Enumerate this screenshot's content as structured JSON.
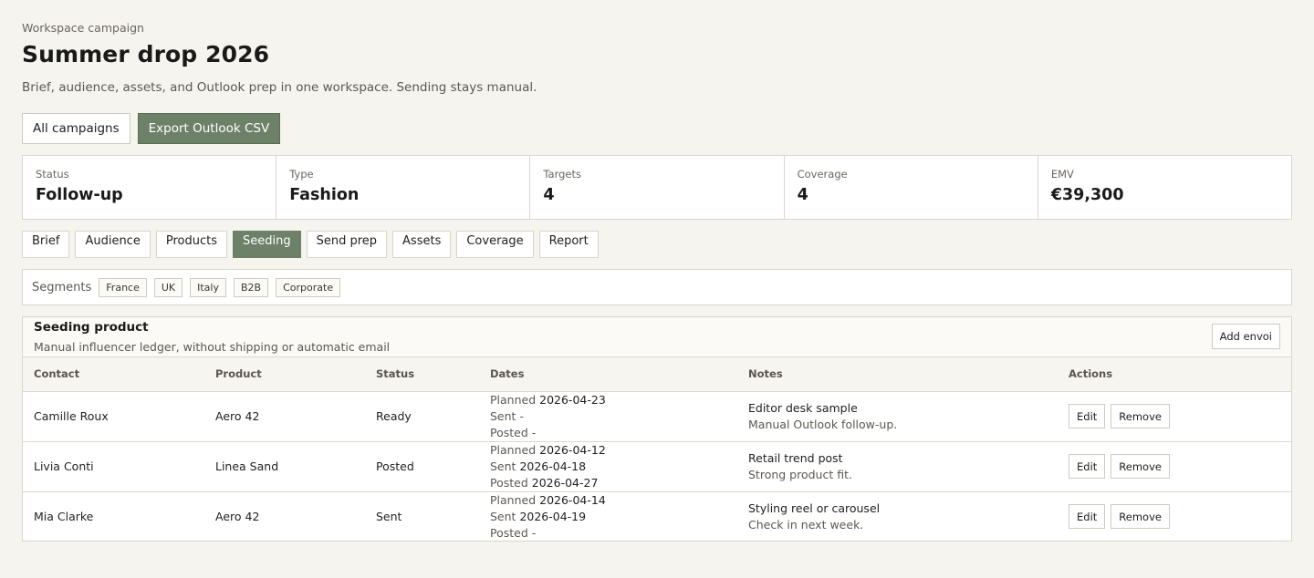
{
  "header": {
    "eyebrow": "Workspace campaign",
    "title": "Summer drop 2026",
    "subtitle": "Brief, audience, assets, and Outlook prep in one workspace. Sending stays manual."
  },
  "actions": {
    "all_campaigns": "All campaigns",
    "export": "Export Outlook CSV"
  },
  "stats": [
    {
      "label": "Status",
      "value": "Follow-up"
    },
    {
      "label": "Type",
      "value": "Fashion"
    },
    {
      "label": "Targets",
      "value": "4"
    },
    {
      "label": "Coverage",
      "value": "4"
    },
    {
      "label": "EMV",
      "value": "€39,300"
    }
  ],
  "tabs": [
    {
      "label": "Brief",
      "active": false
    },
    {
      "label": "Audience",
      "active": false
    },
    {
      "label": "Products",
      "active": false
    },
    {
      "label": "Seeding",
      "active": true
    },
    {
      "label": "Send prep",
      "active": false
    },
    {
      "label": "Assets",
      "active": false
    },
    {
      "label": "Coverage",
      "active": false
    },
    {
      "label": "Report",
      "active": false
    }
  ],
  "segments": {
    "label": "Segments",
    "chips": [
      "France",
      "UK",
      "Italy",
      "B2B",
      "Corporate"
    ]
  },
  "panel": {
    "title": "Seeding product",
    "subtitle": "Manual influencer ledger, without shipping or automatic email",
    "add_button": "Add envoi",
    "columns": [
      "Contact",
      "Product",
      "Status",
      "Dates",
      "Notes",
      "Actions"
    ],
    "date_labels": {
      "planned": "Planned",
      "sent": "Sent",
      "posted": "Posted"
    },
    "action_labels": {
      "edit": "Edit",
      "remove": "Remove"
    },
    "rows": [
      {
        "contact": "Camille Roux",
        "product": "Aero 42",
        "status": "Ready",
        "planned": "2026-04-23",
        "sent": "-",
        "posted": "-",
        "note": "Editor desk sample",
        "note_sub": "Manual Outlook follow-up."
      },
      {
        "contact": "Livia Conti",
        "product": "Linea Sand",
        "status": "Posted",
        "planned": "2026-04-12",
        "sent": "2026-04-18",
        "posted": "2026-04-27",
        "note": "Retail trend post",
        "note_sub": "Strong product fit."
      },
      {
        "contact": "Mia Clarke",
        "product": "Aero 42",
        "status": "Sent",
        "planned": "2026-04-14",
        "sent": "2026-04-19",
        "posted": "-",
        "note": "Styling reel or carousel",
        "note_sub": "Check in next week."
      }
    ]
  },
  "colors": {
    "accent": "#6d8169",
    "background": "#f6f4ee",
    "border": "#d9d5cc"
  }
}
